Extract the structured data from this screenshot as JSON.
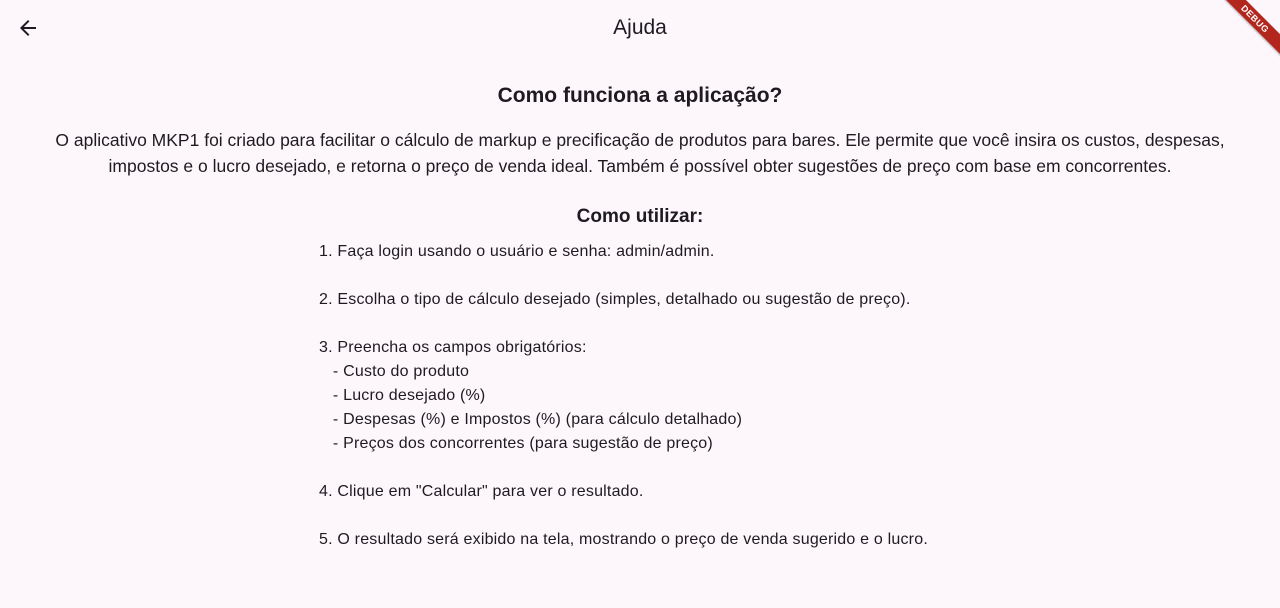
{
  "appbar": {
    "title": "Ajuda",
    "back_icon": "arrow-back-icon",
    "debug_label": "DEBUG"
  },
  "content": {
    "heading": "Como funciona a aplicação?",
    "intro": "O aplicativo MKP1 foi criado para facilitar o cálculo de markup e precificação de produtos para bares. Ele permite que você insira os custos, despesas, impostos e o lucro desejado, e retorna o preço de venda ideal. Também é possível obter sugestões de preço com base em concorrentes.",
    "how_to_heading": "Como utilizar:",
    "steps": [
      "1. Faça login usando o usuário e senha: admin/admin.",
      "",
      "2. Escolha o tipo de cálculo desejado (simples, detalhado ou sugestão de preço).",
      "",
      "3. Preencha os campos obrigatórios:",
      "   - Custo do produto",
      "   - Lucro desejado (%)",
      "   - Despesas (%) e Impostos (%) (para cálculo detalhado)",
      "   - Preços dos concorrentes (para sugestão de preço)",
      "",
      "4. Clique em \"Calcular\" para ver o resultado.",
      "",
      "5. O resultado será exibido na tela, mostrando o preço de venda sugerido e o lucro."
    ]
  },
  "colors": {
    "background": "#fdf7fc",
    "text": "#1d1b20",
    "debug_banner": "#b3261e"
  }
}
